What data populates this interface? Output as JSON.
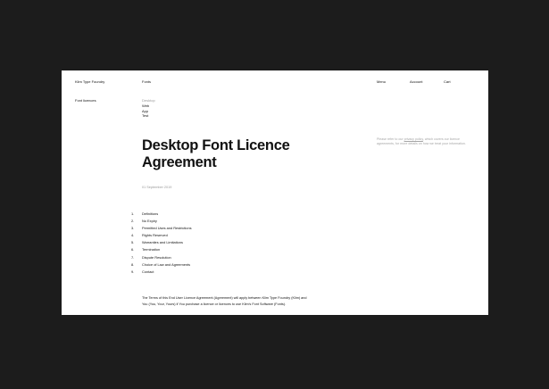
{
  "header": {
    "site_name": "Klim Type Foundry",
    "nav_fonts": "Fonts",
    "nav_menu": "Menu",
    "nav_account": "Account",
    "nav_cart": "Cart"
  },
  "sidebar": {
    "section_label": "Font licences"
  },
  "licence_tabs": [
    {
      "label": "Desktop",
      "active": true
    },
    {
      "label": "Web",
      "active": false
    },
    {
      "label": "App",
      "active": false
    },
    {
      "label": "Test",
      "active": false
    }
  ],
  "main": {
    "title": "Desktop Font Licence Agreement",
    "date": "01 September 2019"
  },
  "aside": {
    "text_before": "Please refer to our ",
    "link_text": "privacy policy",
    "text_after": ", which covers our licence agreements, for more details on how we treat your information."
  },
  "toc": [
    {
      "number": "1.",
      "label": "Definitions"
    },
    {
      "number": "2.",
      "label": "No Expiry"
    },
    {
      "number": "3.",
      "label": "Permitted Uses and Restrictions"
    },
    {
      "number": "4.",
      "label": "Rights Reserved"
    },
    {
      "number": "5.",
      "label": "Warranties and Limitations"
    },
    {
      "number": "6.",
      "label": "Termination"
    },
    {
      "number": "7.",
      "label": "Dispute Resolution"
    },
    {
      "number": "8.",
      "label": "Choice of Law and Agreements"
    },
    {
      "number": "9.",
      "label": "Contact"
    }
  ],
  "intro": {
    "text": "The Terms of this End User Licence Agreement (Agreement) will apply between Klim Type Foundry (Klim) and You (You, Your, Yours) if You purchase a licence or licences to use Klim’s Font Software (Fonts)."
  }
}
